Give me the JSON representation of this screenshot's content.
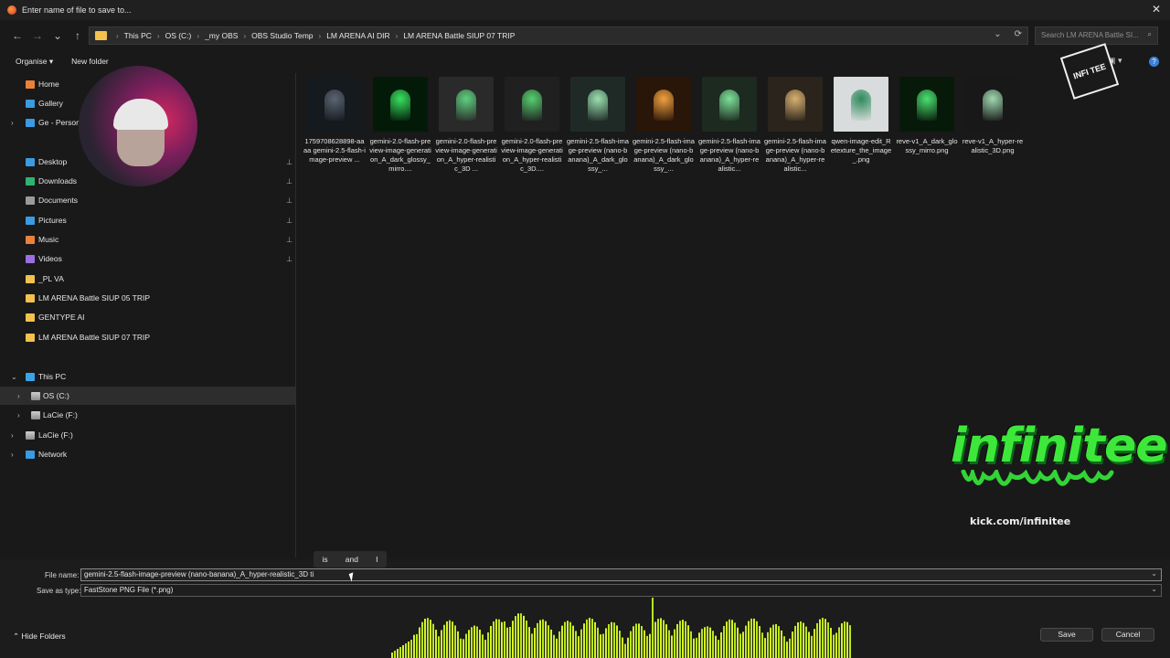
{
  "window": {
    "title": "Enter name of file to save to...",
    "close_glyph": "✕"
  },
  "nav": {
    "back": "←",
    "forward": "→",
    "recent": "⌄",
    "up": "↑"
  },
  "address": {
    "crumbs": [
      "This PC",
      "OS (C:)",
      "_my OBS",
      "OBS Studio Temp",
      "LM ARENA AI DIR",
      "LM ARENA Battle SIUP 07 TRIP"
    ],
    "separator": "›",
    "dropdown": "⌄",
    "refresh": "⟳"
  },
  "search": {
    "placeholder": "Search LM ARENA Battle SI...",
    "icon": "⌕"
  },
  "toolbar": {
    "organise": "Organise ▾",
    "new_folder": "New folder",
    "help": "?",
    "view_icons": "▣ ▾"
  },
  "sidebar": {
    "items": [
      {
        "label": "Home",
        "icon": "home-icon"
      },
      {
        "label": "Gallery",
        "icon": "gallery-icon"
      },
      {
        "label": "Ge - Person",
        "icon": "cloud-icon"
      },
      {
        "label": "Desktop",
        "icon": "desktop-icon"
      },
      {
        "label": "Downloads",
        "icon": "downloads-icon"
      },
      {
        "label": "Documents",
        "icon": "documents-icon"
      },
      {
        "label": "Pictures",
        "icon": "pictures-icon"
      },
      {
        "label": "Music",
        "icon": "music-icon"
      },
      {
        "label": "Videos",
        "icon": "videos-icon"
      },
      {
        "label": "_PL VA",
        "icon": "folder-icon"
      },
      {
        "label": "LM ARENA Battle SIUP 05 TRIP",
        "icon": "folder-icon"
      },
      {
        "label": "GENTYPE AI",
        "icon": "folder-icon"
      },
      {
        "label": "LM ARENA Battle SIUP 07 TRIP",
        "icon": "folder-icon"
      },
      {
        "label": "This PC",
        "icon": "pc-icon"
      },
      {
        "label": "OS (C:)",
        "icon": "drive-icon"
      },
      {
        "label": "LaCie (F:)",
        "icon": "drive-icon"
      },
      {
        "label": "LaCie (F:)",
        "icon": "drive-icon"
      },
      {
        "label": "Network",
        "icon": "network-icon"
      }
    ],
    "pin_glyph": "📌",
    "expand_glyph": "›",
    "collapse_glyph": "⌄"
  },
  "files": [
    {
      "name": "1759708628898-aaaa gemini-2.5-flash-image-preview ...",
      "tone": "#151a1f",
      "accent": "#5a6470"
    },
    {
      "name": "gemini-2.0-flash-preview-image-generation_A_dark_glossy_mirro....",
      "tone": "#031a08",
      "accent": "#38e060"
    },
    {
      "name": "gemini-2.0-flash-preview-image-generation_A_hyper-realistic_3D ...",
      "tone": "#2a2a2a",
      "accent": "#5ed07f"
    },
    {
      "name": "gemini-2.0-flash-preview-image-generation_A_hyper-realistic_3D....",
      "tone": "#202020",
      "accent": "#56cf6f"
    },
    {
      "name": "gemini-2.5-flash-image-preview (nano-banana)_A_dark_glossy_...",
      "tone": "#1f2a26",
      "accent": "#9ae0b0"
    },
    {
      "name": "gemini-2.5-flash-image-preview (nano-banana)_A_dark_glossy_...",
      "tone": "#2a1608",
      "accent": "#f0a040"
    },
    {
      "name": "gemini-2.5-flash-image-preview (nano-banana)_A_hyper-realistic...",
      "tone": "#1c2a20",
      "accent": "#7ee09a"
    },
    {
      "name": "gemini-2.5-flash-image-preview (nano-banana)_A_hyper-realistic...",
      "tone": "#2b241c",
      "accent": "#d8b070"
    },
    {
      "name": "qwen-image-edit_Retexture_the_image_.png",
      "tone": "#d8dcdc",
      "accent": "#2e8a5c"
    },
    {
      "name": "reve-v1_A_dark_glossy_mirro.png",
      "tone": "#071a0a",
      "accent": "#4ce070"
    },
    {
      "name": "reve-v1_A_hyper-realistic_3D.png",
      "tone": "#181818",
      "accent": "#a0d8b0"
    }
  ],
  "overlay": {
    "cube_text": "INFI TEE",
    "brand": "infinitee",
    "brand_url": "kick.com/infinitee"
  },
  "suggestions": [
    "is",
    "and",
    "I"
  ],
  "form": {
    "file_name_label": "File name:",
    "file_name_value": "gemini-2.5-flash-image-preview (nano-banana)_A_hyper-realistic_3D ti",
    "save_type_label": "Save as type:",
    "save_type_value": "FastStone PNG File (*.png)",
    "chevron": "⌄"
  },
  "footer": {
    "hide_folders": "Hide Folders",
    "hide_glyph": "⌃",
    "save": "Save",
    "cancel": "Cancel"
  },
  "colors": {
    "accent_green": "#3ee83a",
    "folder_yellow": "#f2c14e",
    "help_blue": "#3b7fd9"
  }
}
